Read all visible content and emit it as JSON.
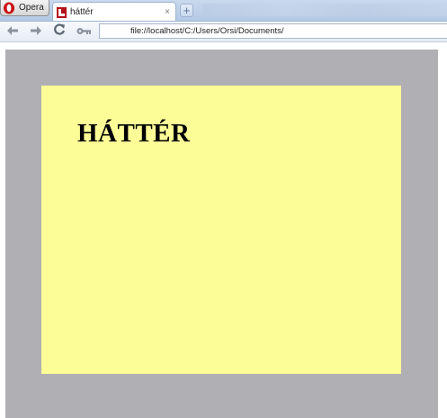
{
  "opera_menu": {
    "label": "Opera"
  },
  "tab": {
    "title": "háttér",
    "close": "×"
  },
  "new_tab": {
    "symbol": "+"
  },
  "address": {
    "url": "file://localhost/C:/Users/Orsi/Documents/"
  },
  "page": {
    "heading": "HÁTTÉR",
    "colors": {
      "page_background": "#b0afb4",
      "box_background": "#fdfd98"
    }
  },
  "icons": {
    "back": "back-arrow-icon",
    "forward": "forward-arrow-icon",
    "reload": "reload-icon",
    "key": "key-icon"
  }
}
